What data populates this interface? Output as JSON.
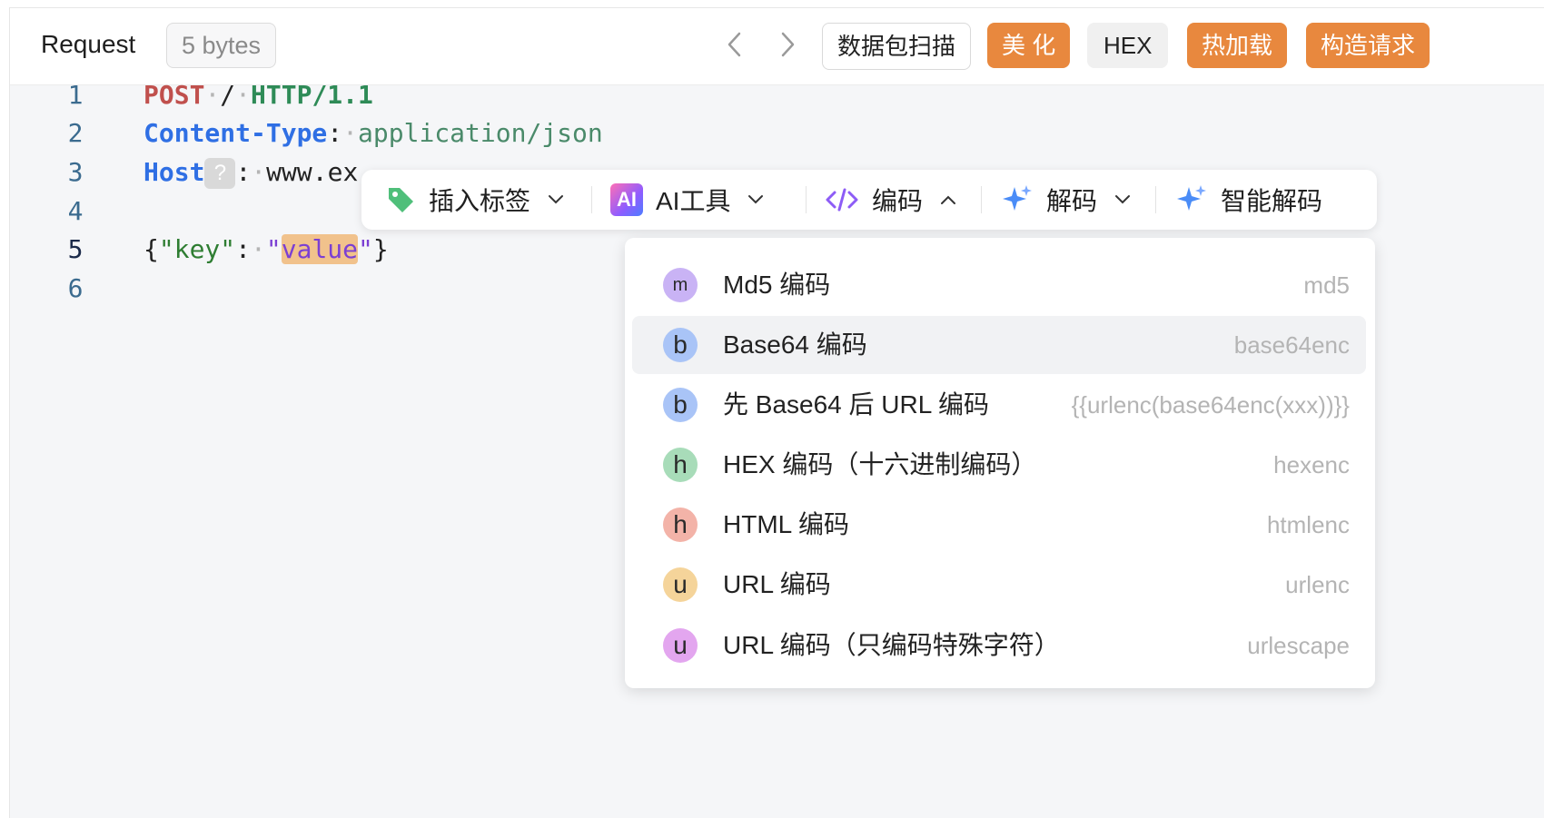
{
  "header": {
    "title": "Request",
    "bytes": "5 bytes",
    "buttons": {
      "scan": "数据包扫描",
      "beautify": "美 化",
      "hex": "HEX",
      "hot_load": "热加载",
      "build_request": "构造请求"
    }
  },
  "editor": {
    "line_numbers": [
      "1",
      "2",
      "3",
      "4",
      "5",
      "6"
    ],
    "active_line": 5,
    "line1": {
      "method": "POST",
      "path": "/",
      "version": "HTTP/1.1"
    },
    "line2": {
      "key": "Content-Type",
      "value": "application/json"
    },
    "line3": {
      "key": "Host",
      "value": "www.ex"
    },
    "line5": {
      "open": "{",
      "json_key": "\"key\"",
      "colon": ":",
      "quote_open": "\"",
      "json_value": "value",
      "quote_close": "\"",
      "close": "}"
    },
    "qmark": "?"
  },
  "toolbar": {
    "insert_tag": "插入标签",
    "ai_tools": "AI工具",
    "ai_badge": "AI",
    "encode": "编码",
    "decode": "解码",
    "smart_decode": "智能解码"
  },
  "encode_menu": {
    "items": [
      {
        "letter": "m",
        "label": "Md5 编码",
        "tag": "md5",
        "color": "#c9b3f5"
      },
      {
        "letter": "b",
        "label": "Base64 编码",
        "tag": "base64enc",
        "color": "#a9c4f7"
      },
      {
        "letter": "b",
        "label": "先 Base64 后 URL 编码",
        "tag": "{{urlenc(base64enc(xxx))}}",
        "color": "#a9c4f7"
      },
      {
        "letter": "h",
        "label": "HEX 编码（十六进制编码）",
        "tag": "hexenc",
        "color": "#a8dcb9"
      },
      {
        "letter": "h",
        "label": "HTML 编码",
        "tag": "htmlenc",
        "color": "#f3b3a8"
      },
      {
        "letter": "u",
        "label": "URL 编码",
        "tag": "urlenc",
        "color": "#f5d49a"
      },
      {
        "letter": "u",
        "label": "URL 编码（只编码特殊字符）",
        "tag": "urlescape",
        "color": "#e3a6ef"
      }
    ],
    "hovered_index": 1
  }
}
